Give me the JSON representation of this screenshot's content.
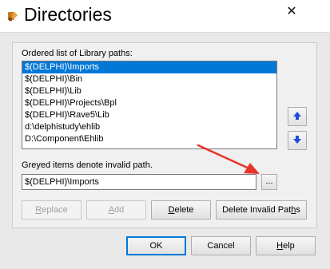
{
  "window": {
    "title": "Directories",
    "close_symbol": "✕"
  },
  "library_paths": {
    "label": "Ordered list of Library paths:",
    "items": [
      "$(DELPHI)\\Imports",
      "$(DELPHI)\\Bin",
      "$(DELPHI)\\Lib",
      "$(DELPHI)\\Projects\\Bpl",
      "$(DELPHI)\\Rave5\\Lib",
      "d:\\delphistudy\\ehlib",
      "D:\\Component\\Ehlib"
    ],
    "selected_index": 0
  },
  "path_editor": {
    "greyed_note": "Greyed items denote invalid path.",
    "value": "$(DELPHI)\\Imports",
    "browse_label": "..."
  },
  "actions": {
    "replace_label_prefix": "",
    "replace_label_key": "R",
    "replace_label_rest": "eplace",
    "add_label_prefix": "",
    "add_label_key": "A",
    "add_label_rest": "dd",
    "delete_label_prefix": "",
    "delete_label_key": "D",
    "delete_label_rest": "elete",
    "delete_invalid_label_prefix": "Delete Invalid Pat",
    "delete_invalid_label_key": "h",
    "delete_invalid_label_rest": "s"
  },
  "dialog_buttons": {
    "ok_label": "OK",
    "cancel_label": "Cancel",
    "help_label_prefix": "",
    "help_label_key": "H",
    "help_label_rest": "elp"
  },
  "colors": {
    "selection": "#0078d7",
    "arrow_blue": "#1f4fd8",
    "annotation_red": "#e8332a"
  },
  "icons": {
    "app": "delphi-app-icon",
    "move_up": "arrow-up-icon",
    "move_down": "arrow-down-icon",
    "close": "close-icon"
  }
}
